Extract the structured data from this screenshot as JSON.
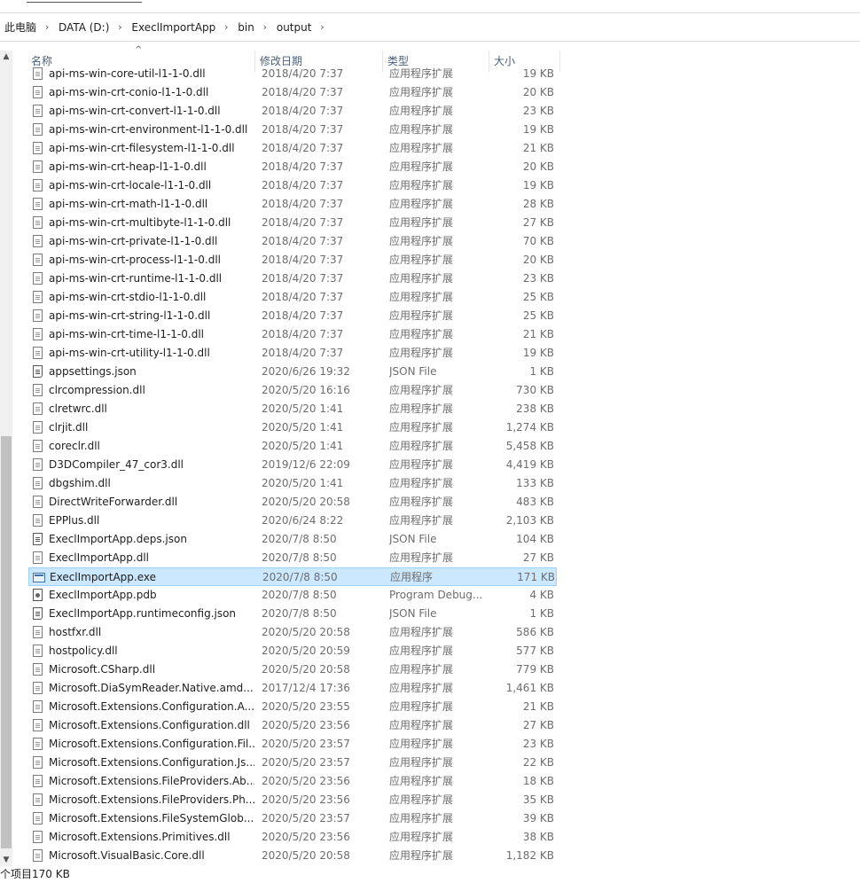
{
  "breadcrumb": [
    "此电脑",
    "DATA (D:)",
    "ExeclImportApp",
    "bin",
    "output"
  ],
  "columns": {
    "name": "名称",
    "date": "修改日期",
    "type": "类型",
    "size": "大小"
  },
  "files": [
    {
      "name": "api-ms-win-core-util-l1-1-0.dll",
      "date": "2018/4/20 7:37",
      "type": "应用程序扩展",
      "size": "19 KB",
      "icon": "dll-file-icon"
    },
    {
      "name": "api-ms-win-crt-conio-l1-1-0.dll",
      "date": "2018/4/20 7:37",
      "type": "应用程序扩展",
      "size": "20 KB",
      "icon": "dll-file-icon"
    },
    {
      "name": "api-ms-win-crt-convert-l1-1-0.dll",
      "date": "2018/4/20 7:37",
      "type": "应用程序扩展",
      "size": "23 KB",
      "icon": "dll-file-icon"
    },
    {
      "name": "api-ms-win-crt-environment-l1-1-0.dll",
      "date": "2018/4/20 7:37",
      "type": "应用程序扩展",
      "size": "19 KB",
      "icon": "dll-file-icon"
    },
    {
      "name": "api-ms-win-crt-filesystem-l1-1-0.dll",
      "date": "2018/4/20 7:37",
      "type": "应用程序扩展",
      "size": "21 KB",
      "icon": "dll-file-icon"
    },
    {
      "name": "api-ms-win-crt-heap-l1-1-0.dll",
      "date": "2018/4/20 7:37",
      "type": "应用程序扩展",
      "size": "20 KB",
      "icon": "dll-file-icon"
    },
    {
      "name": "api-ms-win-crt-locale-l1-1-0.dll",
      "date": "2018/4/20 7:37",
      "type": "应用程序扩展",
      "size": "19 KB",
      "icon": "dll-file-icon"
    },
    {
      "name": "api-ms-win-crt-math-l1-1-0.dll",
      "date": "2018/4/20 7:37",
      "type": "应用程序扩展",
      "size": "28 KB",
      "icon": "dll-file-icon"
    },
    {
      "name": "api-ms-win-crt-multibyte-l1-1-0.dll",
      "date": "2018/4/20 7:37",
      "type": "应用程序扩展",
      "size": "27 KB",
      "icon": "dll-file-icon"
    },
    {
      "name": "api-ms-win-crt-private-l1-1-0.dll",
      "date": "2018/4/20 7:37",
      "type": "应用程序扩展",
      "size": "70 KB",
      "icon": "dll-file-icon"
    },
    {
      "name": "api-ms-win-crt-process-l1-1-0.dll",
      "date": "2018/4/20 7:37",
      "type": "应用程序扩展",
      "size": "20 KB",
      "icon": "dll-file-icon"
    },
    {
      "name": "api-ms-win-crt-runtime-l1-1-0.dll",
      "date": "2018/4/20 7:37",
      "type": "应用程序扩展",
      "size": "23 KB",
      "icon": "dll-file-icon"
    },
    {
      "name": "api-ms-win-crt-stdio-l1-1-0.dll",
      "date": "2018/4/20 7:37",
      "type": "应用程序扩展",
      "size": "25 KB",
      "icon": "dll-file-icon"
    },
    {
      "name": "api-ms-win-crt-string-l1-1-0.dll",
      "date": "2018/4/20 7:37",
      "type": "应用程序扩展",
      "size": "25 KB",
      "icon": "dll-file-icon"
    },
    {
      "name": "api-ms-win-crt-time-l1-1-0.dll",
      "date": "2018/4/20 7:37",
      "type": "应用程序扩展",
      "size": "21 KB",
      "icon": "dll-file-icon"
    },
    {
      "name": "api-ms-win-crt-utility-l1-1-0.dll",
      "date": "2018/4/20 7:37",
      "type": "应用程序扩展",
      "size": "19 KB",
      "icon": "dll-file-icon"
    },
    {
      "name": "appsettings.json",
      "date": "2020/6/26 19:32",
      "type": "JSON File",
      "size": "1 KB",
      "icon": "json-file-icon"
    },
    {
      "name": "clrcompression.dll",
      "date": "2020/5/20 16:16",
      "type": "应用程序扩展",
      "size": "730 KB",
      "icon": "dll-file-icon"
    },
    {
      "name": "clretwrc.dll",
      "date": "2020/5/20 1:41",
      "type": "应用程序扩展",
      "size": "238 KB",
      "icon": "dll-file-icon"
    },
    {
      "name": "clrjit.dll",
      "date": "2020/5/20 1:41",
      "type": "应用程序扩展",
      "size": "1,274 KB",
      "icon": "dll-file-icon"
    },
    {
      "name": "coreclr.dll",
      "date": "2020/5/20 1:41",
      "type": "应用程序扩展",
      "size": "5,458 KB",
      "icon": "dll-file-icon"
    },
    {
      "name": "D3DCompiler_47_cor3.dll",
      "date": "2019/12/6 22:09",
      "type": "应用程序扩展",
      "size": "4,419 KB",
      "icon": "dll-file-icon"
    },
    {
      "name": "dbgshim.dll",
      "date": "2020/5/20 1:41",
      "type": "应用程序扩展",
      "size": "133 KB",
      "icon": "dll-file-icon"
    },
    {
      "name": "DirectWriteForwarder.dll",
      "date": "2020/5/20 20:58",
      "type": "应用程序扩展",
      "size": "483 KB",
      "icon": "dll-file-icon"
    },
    {
      "name": "EPPlus.dll",
      "date": "2020/6/24 8:22",
      "type": "应用程序扩展",
      "size": "2,103 KB",
      "icon": "dll-file-icon"
    },
    {
      "name": "ExeclImportApp.deps.json",
      "date": "2020/7/8 8:50",
      "type": "JSON File",
      "size": "104 KB",
      "icon": "json-file-icon"
    },
    {
      "name": "ExeclImportApp.dll",
      "date": "2020/7/8 8:50",
      "type": "应用程序扩展",
      "size": "27 KB",
      "icon": "dll-file-icon"
    },
    {
      "name": "ExeclImportApp.exe",
      "date": "2020/7/8 8:50",
      "type": "应用程序",
      "size": "171 KB",
      "icon": "exe-file-icon",
      "selected": true
    },
    {
      "name": "ExeclImportApp.pdb",
      "date": "2020/7/8 8:50",
      "type": "Program Debug...",
      "size": "4 KB",
      "icon": "pdb-file-icon"
    },
    {
      "name": "ExeclImportApp.runtimeconfig.json",
      "date": "2020/7/8 8:50",
      "type": "JSON File",
      "size": "1 KB",
      "icon": "json-file-icon"
    },
    {
      "name": "hostfxr.dll",
      "date": "2020/5/20 20:58",
      "type": "应用程序扩展",
      "size": "586 KB",
      "icon": "dll-file-icon"
    },
    {
      "name": "hostpolicy.dll",
      "date": "2020/5/20 20:59",
      "type": "应用程序扩展",
      "size": "577 KB",
      "icon": "dll-file-icon"
    },
    {
      "name": "Microsoft.CSharp.dll",
      "date": "2020/5/20 20:58",
      "type": "应用程序扩展",
      "size": "779 KB",
      "icon": "dll-file-icon"
    },
    {
      "name": "Microsoft.DiaSymReader.Native.amd...",
      "date": "2017/12/4 17:36",
      "type": "应用程序扩展",
      "size": "1,461 KB",
      "icon": "dll-file-icon"
    },
    {
      "name": "Microsoft.Extensions.Configuration.A...",
      "date": "2020/5/20 23:55",
      "type": "应用程序扩展",
      "size": "21 KB",
      "icon": "dll-file-icon"
    },
    {
      "name": "Microsoft.Extensions.Configuration.dll",
      "date": "2020/5/20 23:56",
      "type": "应用程序扩展",
      "size": "27 KB",
      "icon": "dll-file-icon"
    },
    {
      "name": "Microsoft.Extensions.Configuration.Fil...",
      "date": "2020/5/20 23:57",
      "type": "应用程序扩展",
      "size": "23 KB",
      "icon": "dll-file-icon"
    },
    {
      "name": "Microsoft.Extensions.Configuration.Js...",
      "date": "2020/5/20 23:57",
      "type": "应用程序扩展",
      "size": "22 KB",
      "icon": "dll-file-icon"
    },
    {
      "name": "Microsoft.Extensions.FileProviders.Ab...",
      "date": "2020/5/20 23:56",
      "type": "应用程序扩展",
      "size": "18 KB",
      "icon": "dll-file-icon"
    },
    {
      "name": "Microsoft.Extensions.FileProviders.Ph...",
      "date": "2020/5/20 23:56",
      "type": "应用程序扩展",
      "size": "35 KB",
      "icon": "dll-file-icon"
    },
    {
      "name": "Microsoft.Extensions.FileSystemGlob...",
      "date": "2020/5/20 23:57",
      "type": "应用程序扩展",
      "size": "39 KB",
      "icon": "dll-file-icon"
    },
    {
      "name": "Microsoft.Extensions.Primitives.dll",
      "date": "2020/5/20 23:56",
      "type": "应用程序扩展",
      "size": "38 KB",
      "icon": "dll-file-icon"
    },
    {
      "name": "Microsoft.VisualBasic.Core.dll",
      "date": "2020/5/20 20:58",
      "type": "应用程序扩展",
      "size": "1,182 KB",
      "icon": "dll-file-icon"
    }
  ],
  "status": {
    "count": "个项目",
    "selected": "170 KB"
  },
  "colors": {
    "selection_bg": "#cce8ff",
    "selection_border": "#99d1ff",
    "header_text": "#4c607a"
  }
}
